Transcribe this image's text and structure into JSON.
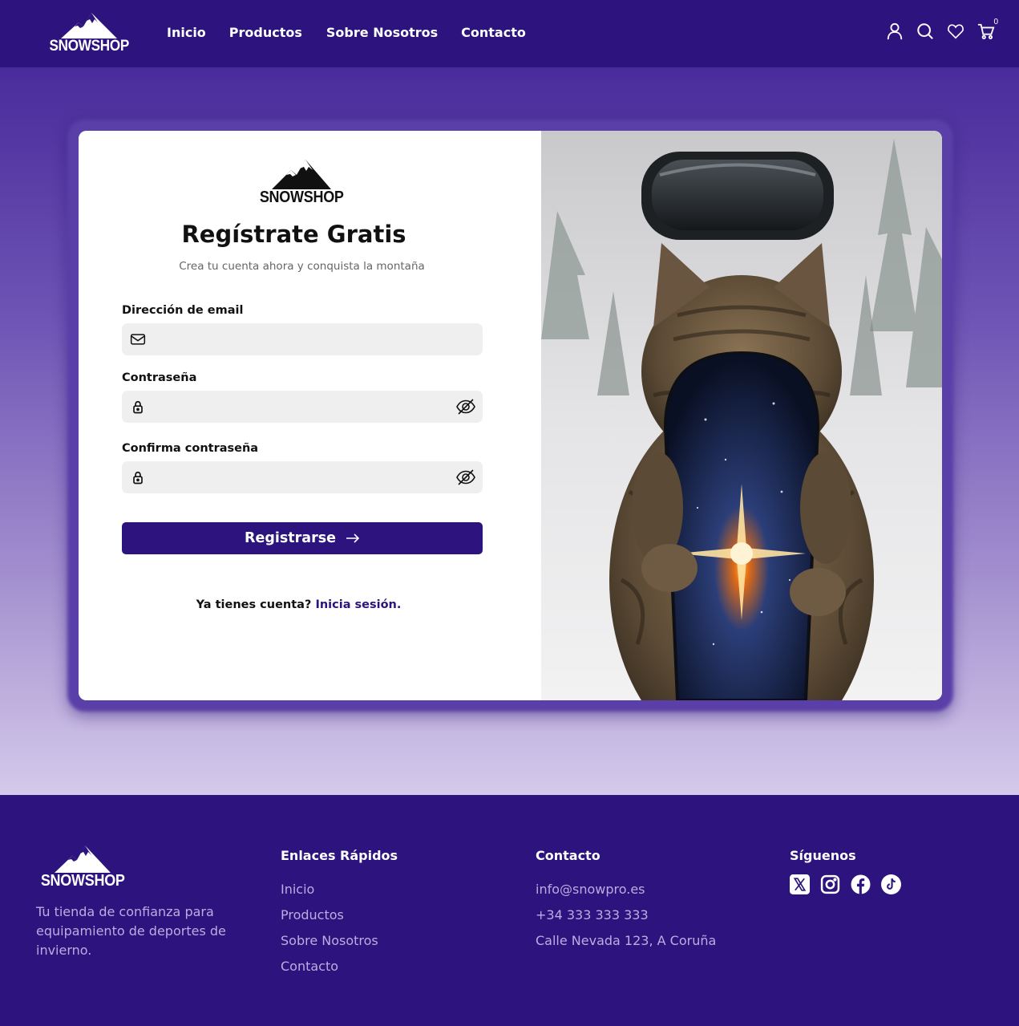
{
  "brand": {
    "name": "SNOWSHOP"
  },
  "nav": {
    "items": [
      {
        "label": "Inicio"
      },
      {
        "label": "Productos"
      },
      {
        "label": "Sobre Nosotros"
      },
      {
        "label": "Contacto"
      }
    ],
    "icons": [
      "user-icon",
      "search-icon",
      "heart-icon",
      "cart-icon"
    ],
    "cart_count": "0"
  },
  "form": {
    "title": "Regístrate Gratis",
    "subtitle": "Crea tu cuenta ahora y conquista la montaña",
    "email": {
      "label": "Dirección de email",
      "value": "",
      "placeholder": ""
    },
    "password": {
      "label": "Contraseña",
      "value": "",
      "placeholder": ""
    },
    "confirm": {
      "label": "Confirma contraseña",
      "value": "",
      "placeholder": ""
    },
    "submit_label": "Registrarse",
    "login_prompt": "Ya tienes cuenta?",
    "login_link": "Inicia sesión."
  },
  "hero_image": {
    "icon": "cat-snowboard-photo"
  },
  "footer": {
    "tagline": "Tu tienda de confianza para equipamiento de deportes de invierno.",
    "links_title": "Enlaces Rápidos",
    "links": [
      {
        "label": "Inicio"
      },
      {
        "label": "Productos"
      },
      {
        "label": "Sobre Nosotros"
      },
      {
        "label": "Contacto"
      }
    ],
    "contact_title": "Contacto",
    "contact": [
      {
        "label": "info@snowpro.es"
      },
      {
        "label": "+34 333 333 333"
      },
      {
        "label": "Calle Nevada 123, A Coruña"
      }
    ],
    "social_title": "Síguenos",
    "socials": [
      "x-icon",
      "instagram-icon",
      "facebook-icon",
      "tiktok-icon"
    ]
  },
  "colors": {
    "primary": "#2c137e",
    "muted_text": "#b9aee0",
    "input_bg": "#efefef"
  }
}
